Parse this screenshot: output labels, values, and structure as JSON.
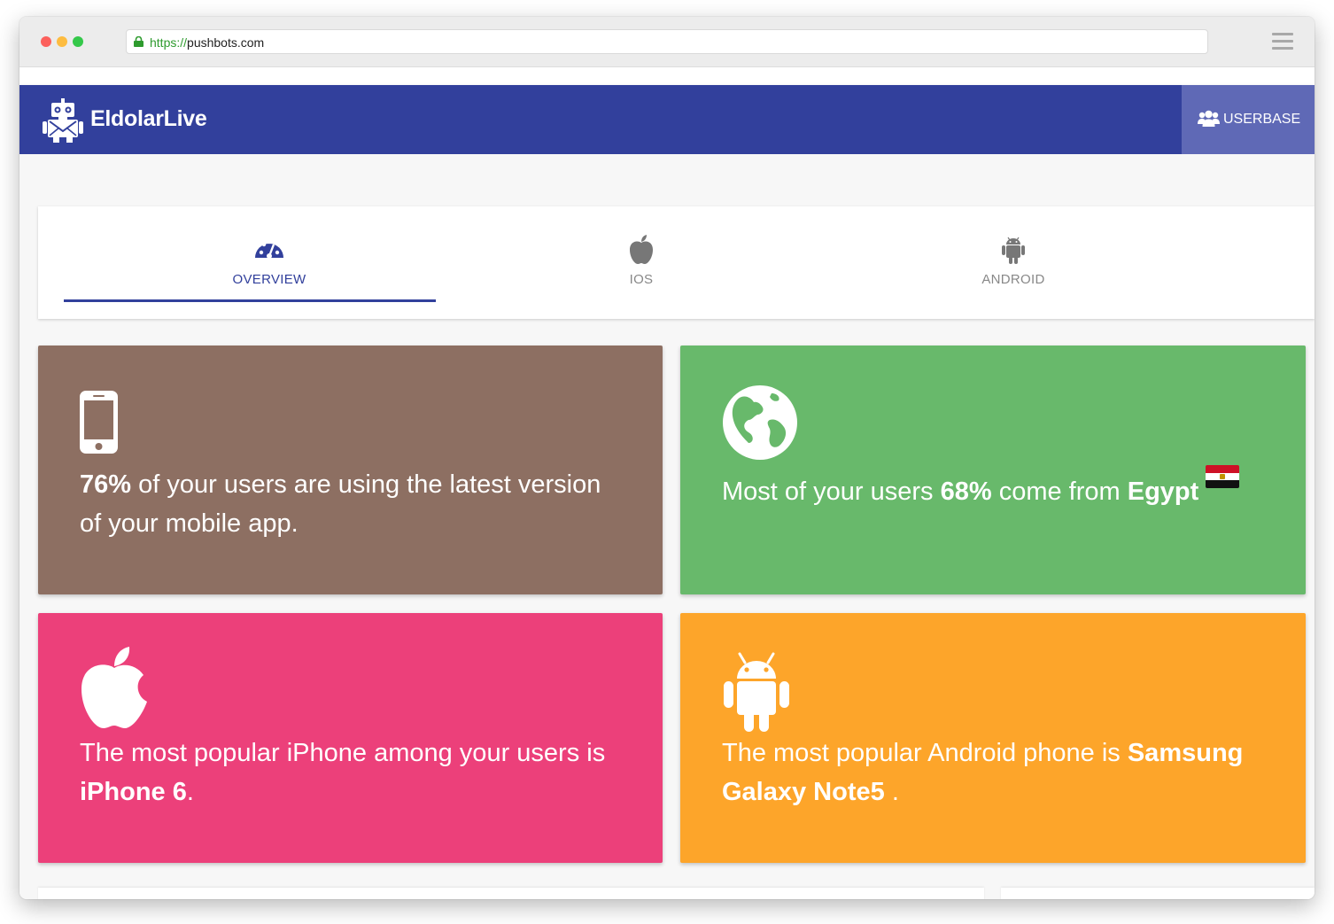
{
  "browser": {
    "url_scheme": "https://",
    "url_host": "pushbots.com"
  },
  "app": {
    "title": "EldolarLive",
    "userbase_label": "USERBASE"
  },
  "tabs": [
    {
      "label": "OVERVIEW",
      "icon": "dashboard-icon",
      "active": true
    },
    {
      "label": "IOS",
      "icon": "apple-icon",
      "active": false
    },
    {
      "label": "ANDROID",
      "icon": "android-icon",
      "active": false
    }
  ],
  "cards": {
    "version": {
      "icon": "mobile-phone-icon",
      "highlight": "76%",
      "text_after": " of your users are using the latest version of your mobile app.",
      "color": "#8d6f62"
    },
    "country": {
      "icon": "globe-icon",
      "text_before": "Most of your users ",
      "percent": "68%",
      "text_mid": " come from ",
      "country": "Egypt",
      "flag_icon": "egypt-flag-icon",
      "color": "#68b96b"
    },
    "iphone": {
      "icon": "apple-icon",
      "text_before": "The most popular iPhone among your users is ",
      "model": "iPhone 6",
      "text_after": ".",
      "color": "#ec407a"
    },
    "android": {
      "icon": "android-icon",
      "text_before": "The most popular Android phone is ",
      "model": "Samsung Galaxy Note5",
      "text_after": " .",
      "color": "#fda52a"
    }
  },
  "colors": {
    "appbar": "#32409c",
    "userbase_button": "#5f69b6",
    "active_tab": "#32409c"
  }
}
